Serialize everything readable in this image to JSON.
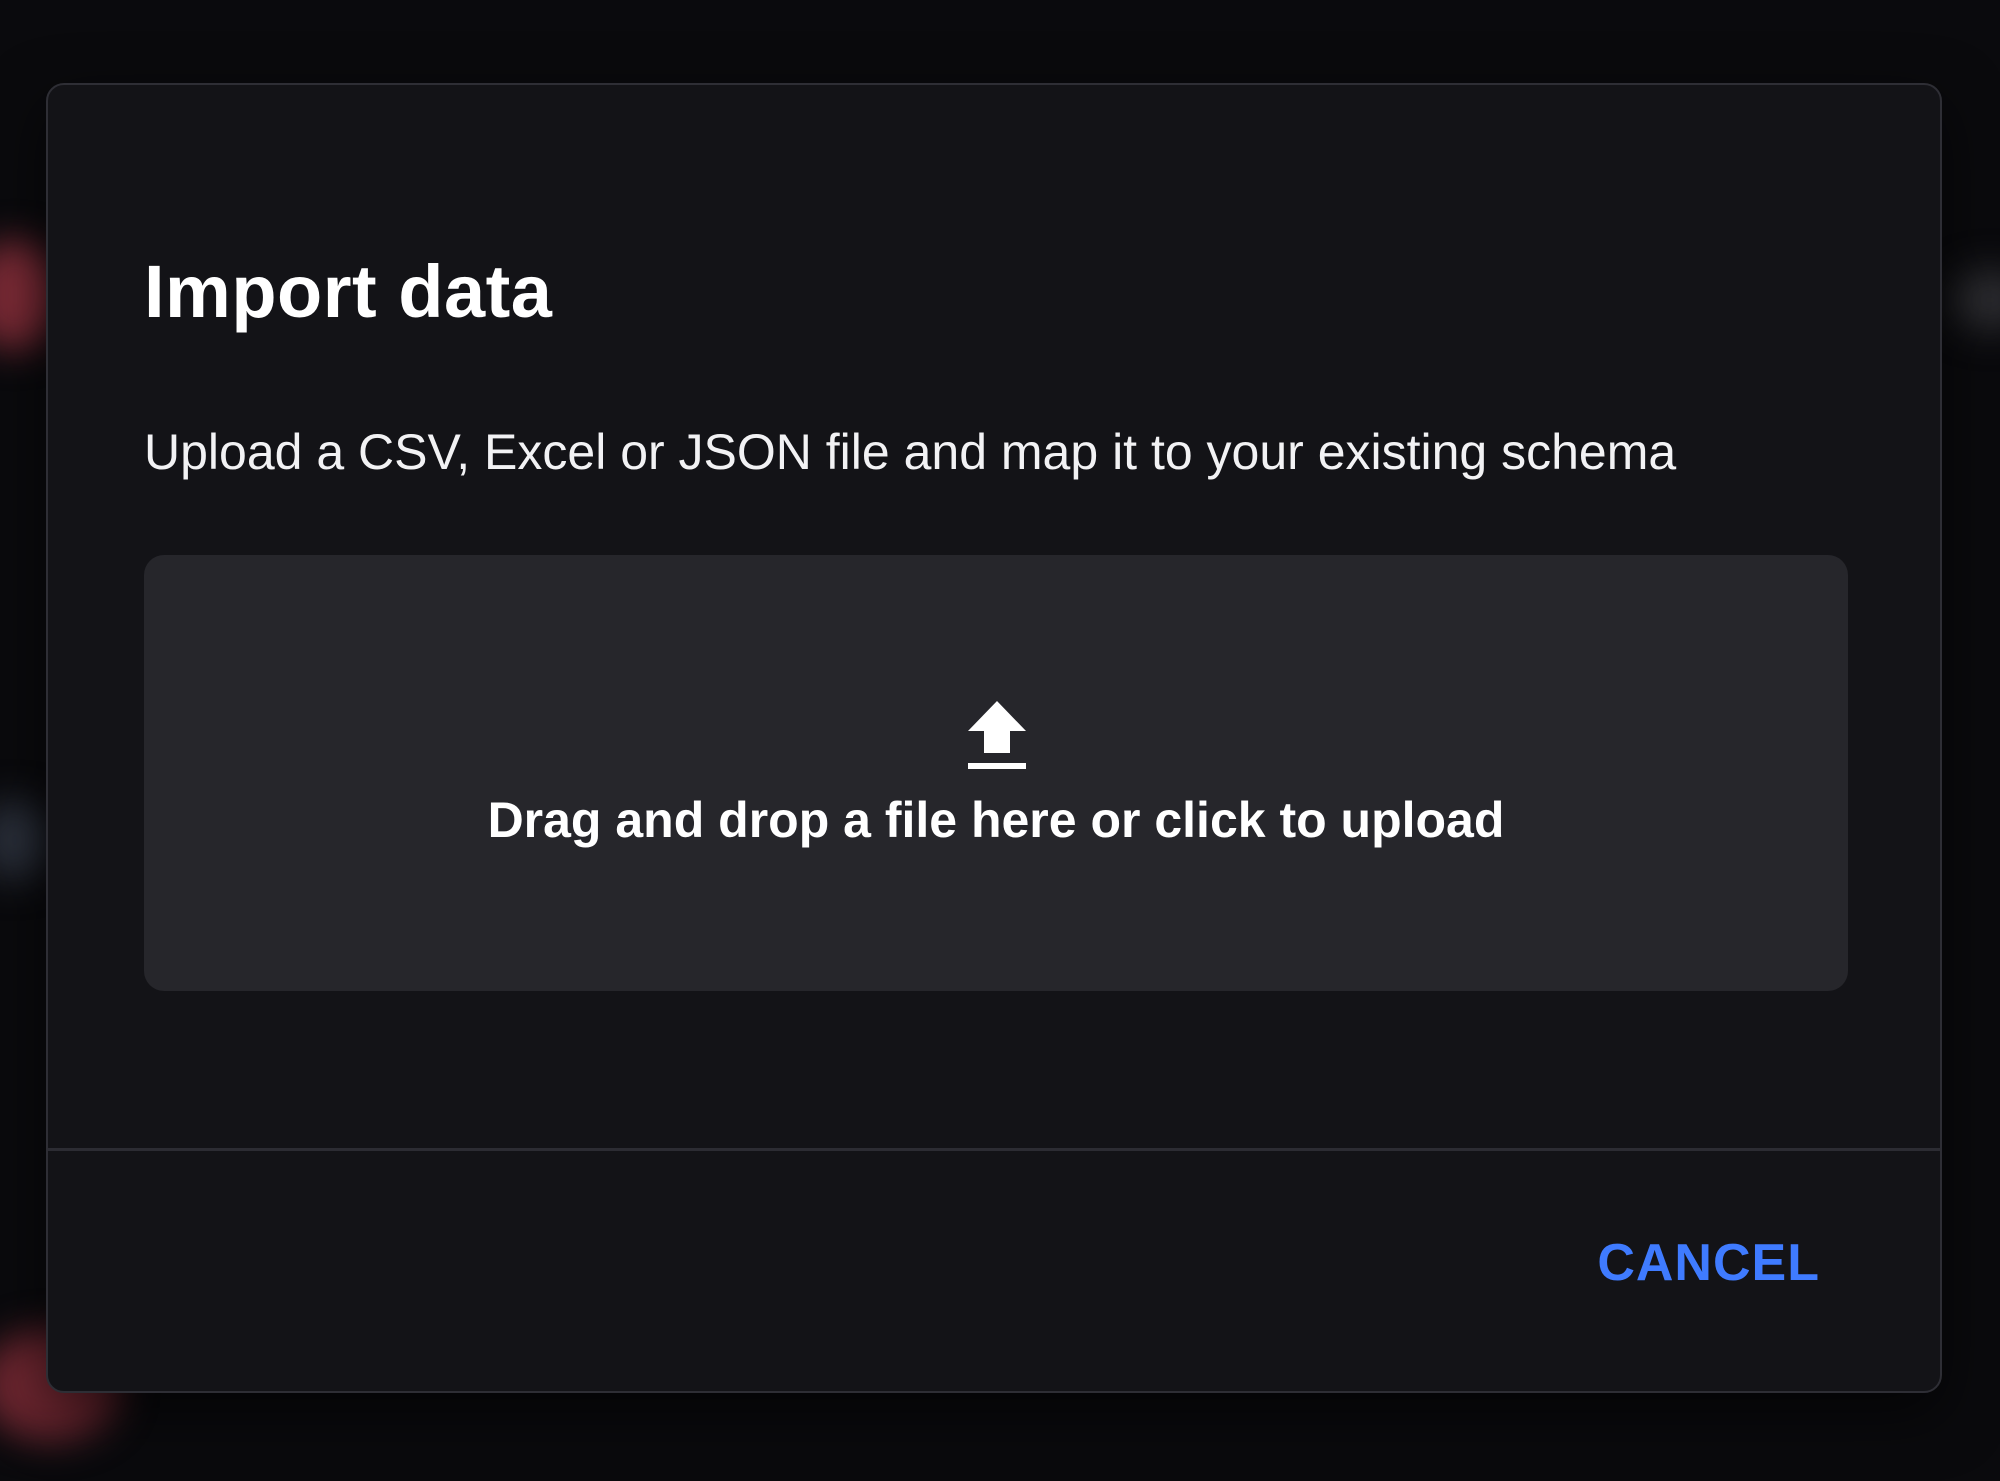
{
  "dialog": {
    "title": "Import data",
    "subtitle": "Upload a CSV, Excel or JSON file and map it to your existing schema",
    "dropzone": {
      "icon": "upload-icon",
      "label": "Drag and drop a file here or click to upload"
    },
    "footer": {
      "cancel_label": "CANCEL"
    }
  },
  "colors": {
    "dialog_background": "#131317",
    "dropzone_background": "#26262b",
    "accent": "#3f7bff",
    "text": "#ffffff"
  }
}
